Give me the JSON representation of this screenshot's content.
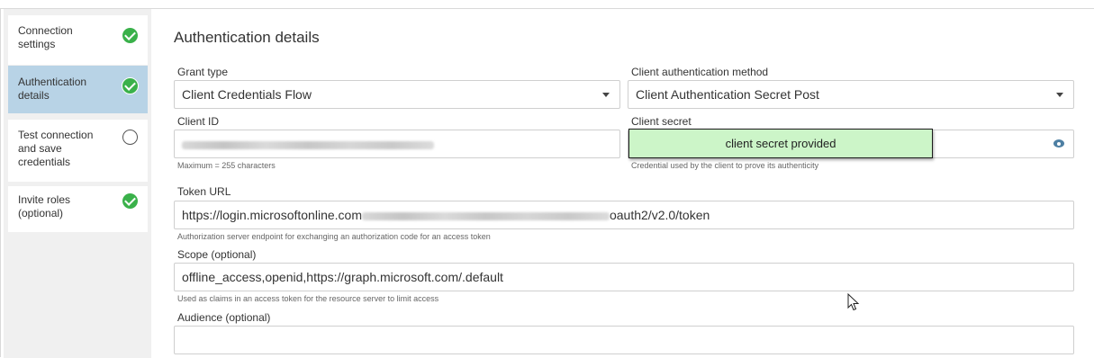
{
  "sidebar": {
    "steps": [
      {
        "label_line1": "Connection",
        "label_line2": "settings",
        "status": "complete"
      },
      {
        "label_line1": "Authentication",
        "label_line2": "details",
        "status": "complete"
      },
      {
        "label_line1": "Test connection",
        "label_line2": "and save",
        "label_line3": "credentials",
        "status": "pending"
      },
      {
        "label_line1": "Invite roles",
        "label_line2": "(optional)",
        "status": "complete"
      }
    ]
  },
  "main": {
    "title": "Authentication details",
    "grant_type": {
      "label": "Grant type",
      "value": "Client Credentials Flow"
    },
    "client_auth_method": {
      "label": "Client authentication method",
      "value": "Client Authentication Secret Post"
    },
    "client_id": {
      "label": "Client ID",
      "hint": "Maximum = 255 characters"
    },
    "client_secret": {
      "label": "Client secret",
      "badge": "client secret provided",
      "hint": "Credential used by the client to prove its authenticity"
    },
    "token_url": {
      "label": "Token URL",
      "value_prefix": "https://login.microsoftonline.com",
      "value_suffix": "oauth2/v2.0/token",
      "hint": "Authorization server endpoint for exchanging an authorization code for an access token"
    },
    "scope": {
      "label": "Scope (optional)",
      "value": "offline_access,openid,https://graph.microsoft.com/.default",
      "hint": "Used as claims in an access token for the resource server to limit access"
    },
    "audience": {
      "label": "Audience (optional)",
      "value": ""
    }
  },
  "colors": {
    "accent_active_step": "#b8d3e6",
    "success": "#3ab14a",
    "badge_bg": "#ccf5c8"
  },
  "icons": {
    "step_complete": "check-circle-icon",
    "step_pending": "empty-circle-icon",
    "dropdown": "caret-down-icon",
    "reveal": "eye-icon"
  }
}
